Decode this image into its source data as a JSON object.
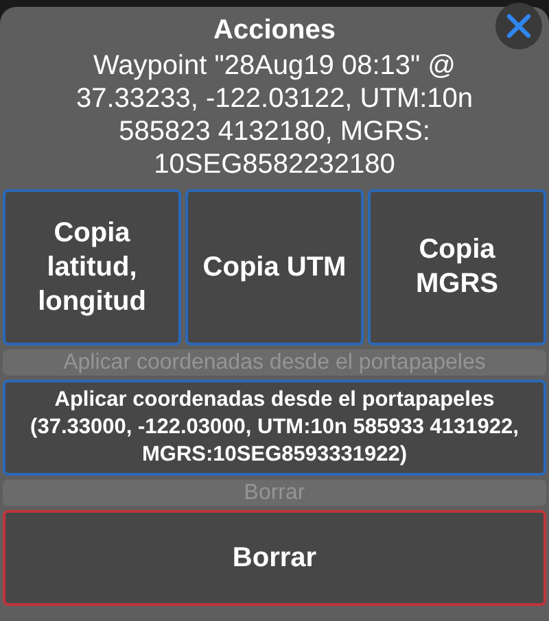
{
  "title": "Acciones",
  "message": "Waypoint \"28Aug19 08:13\" @ 37.33233, -122.03122, UTM:10n 585823 4132180, MGRS: 10SEG8582232180",
  "copy_buttons": [
    {
      "label": "Copia latitud, longitud"
    },
    {
      "label": "Copia UTM"
    },
    {
      "label": "Copia MGRS"
    }
  ],
  "sections": [
    {
      "header": "Aplicar coordenadas desde el portapapeles",
      "button": {
        "kind": "apply",
        "label": "Aplicar coordenadas desde el portapapeles (37.33000, -122.03000, UTM:10n 585933 4131922, MGRS:10SEG8593331922)"
      }
    },
    {
      "header": "Borrar",
      "button": {
        "kind": "delete",
        "label": "Borrar"
      }
    }
  ]
}
